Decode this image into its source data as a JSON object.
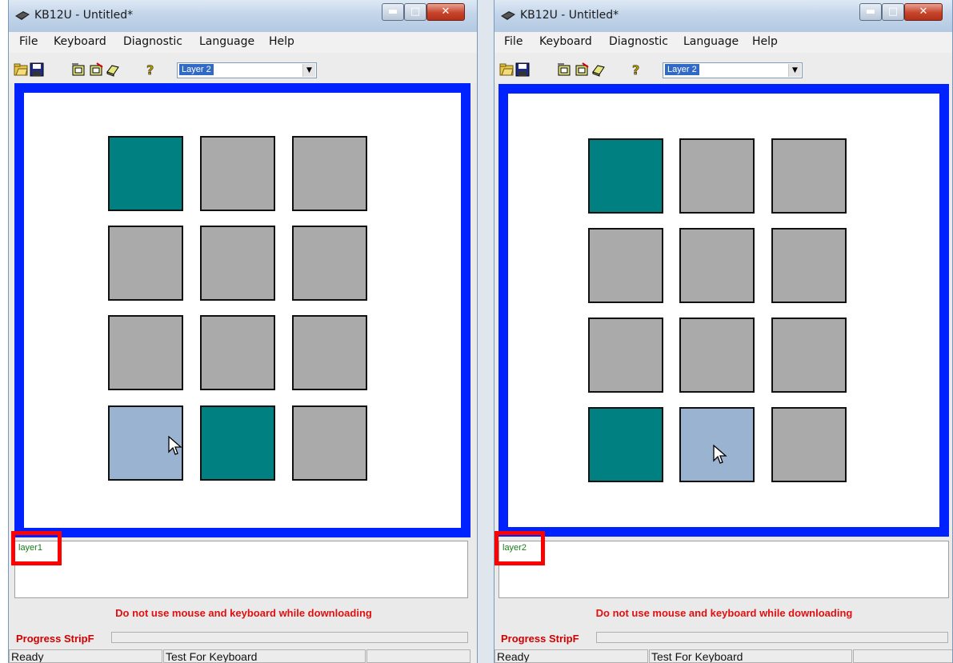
{
  "colors": {
    "canvas_border": "#0022ff",
    "key_active": "#008080",
    "key_inactive": "#aaaaaa",
    "key_hover": "#9ab3d1",
    "highlight_box": "#ff0000",
    "warning_text": "#e01010"
  },
  "windows": [
    {
      "title": "KB12U - Untitled*",
      "menu": [
        "File",
        "Keyboard",
        "Diagnostic",
        "Language",
        "Help"
      ],
      "toolbar_icons": [
        "open-icon",
        "save-icon",
        "read-keyboard-icon",
        "write-keyboard-icon",
        "erase-icon",
        "help-icon"
      ],
      "layer_select": "Layer 2",
      "keys": [
        "active",
        "inactive",
        "inactive",
        "inactive",
        "inactive",
        "inactive",
        "inactive",
        "inactive",
        "inactive",
        "hover",
        "active",
        "inactive"
      ],
      "info_text": "layer1",
      "warning": "Do not use mouse and keyboard while downloading",
      "progress_label": "Progress StripF",
      "status": [
        "Ready",
        "Test For Keyboard",
        ""
      ]
    },
    {
      "title": "KB12U - Untitled*",
      "menu": [
        "File",
        "Keyboard",
        "Diagnostic",
        "Language",
        "Help"
      ],
      "toolbar_icons": [
        "open-icon",
        "save-icon",
        "read-keyboard-icon",
        "write-keyboard-icon",
        "erase-icon",
        "help-icon"
      ],
      "layer_select": "Layer 2",
      "keys": [
        "active",
        "inactive",
        "inactive",
        "inactive",
        "inactive",
        "inactive",
        "inactive",
        "inactive",
        "inactive",
        "active",
        "hover",
        "inactive"
      ],
      "info_text": "layer2",
      "warning": "Do not use mouse and keyboard while downloading",
      "progress_label": "Progress StripF",
      "status": [
        "Ready",
        "Test For Keyboard",
        ""
      ]
    }
  ]
}
